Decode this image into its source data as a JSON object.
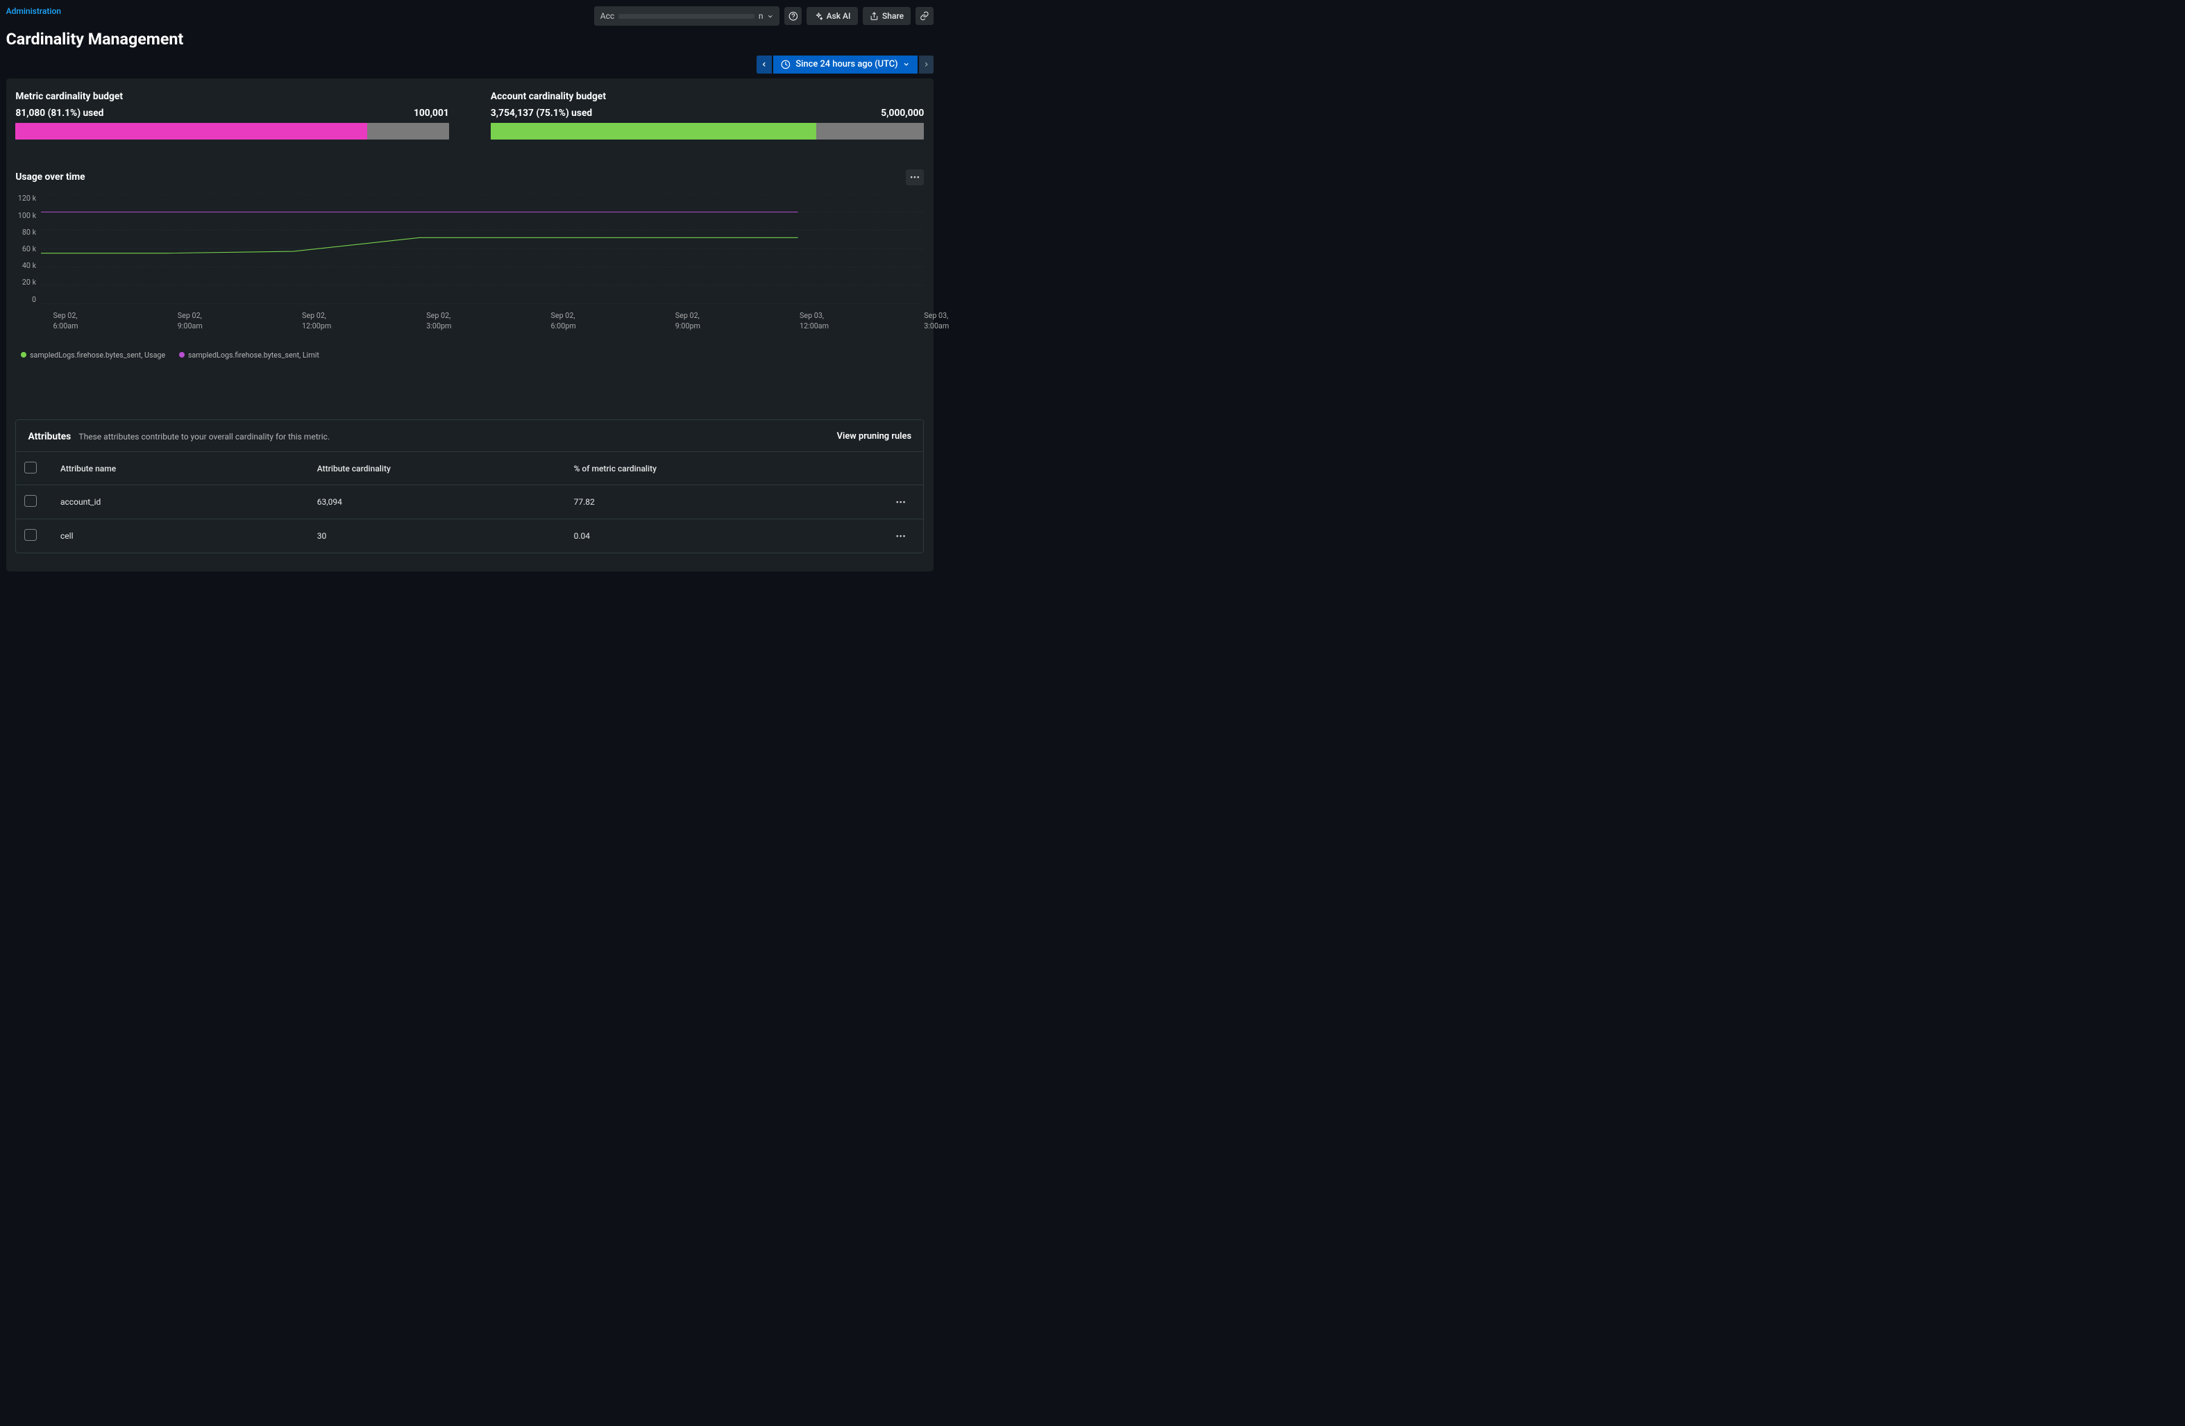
{
  "breadcrumb": {
    "label": "Administration"
  },
  "page": {
    "title": "Cardinality Management"
  },
  "topbar": {
    "account_prefix": "Acc",
    "account_suffix": "n",
    "help_icon": "help-icon",
    "ask_ai_label": "Ask AI",
    "share_label": "Share"
  },
  "time_range": {
    "label": "Since 24 hours ago (UTC)"
  },
  "budgets": {
    "metric": {
      "title": "Metric cardinality budget",
      "used_label": "81,080 (81.1%) used",
      "total_label": "100,001",
      "fill_pct": 81.1,
      "color": "#e93bc0"
    },
    "account": {
      "title": "Account cardinality budget",
      "used_label": "3,754,137 (75.1%) used",
      "total_label": "5,000,000",
      "fill_pct": 75.1,
      "color": "#79d14d"
    }
  },
  "usage": {
    "title": "Usage over time",
    "y_ticks": [
      "120 k",
      "100 k",
      "80 k",
      "60 k",
      "40 k",
      "20 k",
      "0"
    ],
    "x_ticks": [
      "Sep 02,\n6:00am",
      "Sep 02,\n9:00am",
      "Sep 02,\n12:00pm",
      "Sep 02,\n3:00pm",
      "Sep 02,\n6:00pm",
      "Sep 02,\n9:00pm",
      "Sep 03,\n12:00am",
      "Sep 03,\n3:00am"
    ],
    "legend": [
      {
        "label": "sampledLogs.firehose.bytes_sent, Usage",
        "color": "#79d14d"
      },
      {
        "label": "sampledLogs.firehose.bytes_sent, Limit",
        "color": "#b84fd1"
      }
    ]
  },
  "chart_data": {
    "type": "line",
    "title": "Usage over time",
    "xlabel": "",
    "ylabel": "",
    "ylim": [
      0,
      120000
    ],
    "x": [
      "Sep 02 6:00am",
      "Sep 02 9:00am",
      "Sep 02 12:00pm",
      "Sep 02 3:00pm",
      "Sep 02 6:00pm",
      "Sep 02 9:00pm",
      "Sep 03 12:00am",
      "Sep 03 3:00am"
    ],
    "series": [
      {
        "name": "sampledLogs.firehose.bytes_sent, Usage",
        "color": "#79d14d",
        "values": [
          55000,
          55000,
          57000,
          72000,
          72000,
          72000,
          72000,
          null
        ]
      },
      {
        "name": "sampledLogs.firehose.bytes_sent, Limit",
        "color": "#b84fd1",
        "values": [
          100000,
          100000,
          100000,
          100000,
          100000,
          100000,
          100000,
          null
        ]
      }
    ]
  },
  "attributes": {
    "title": "Attributes",
    "subtitle": "These attributes contribute to your overall cardinality for this metric.",
    "view_rules_label": "View pruning rules",
    "columns": {
      "name": "Attribute name",
      "card": "Attribute cardinality",
      "pct": "% of metric cardinality"
    },
    "rows": [
      {
        "name": "account_id",
        "card": "63,094",
        "pct": "77.82"
      },
      {
        "name": "cell",
        "card": "30",
        "pct": "0.04"
      }
    ]
  }
}
